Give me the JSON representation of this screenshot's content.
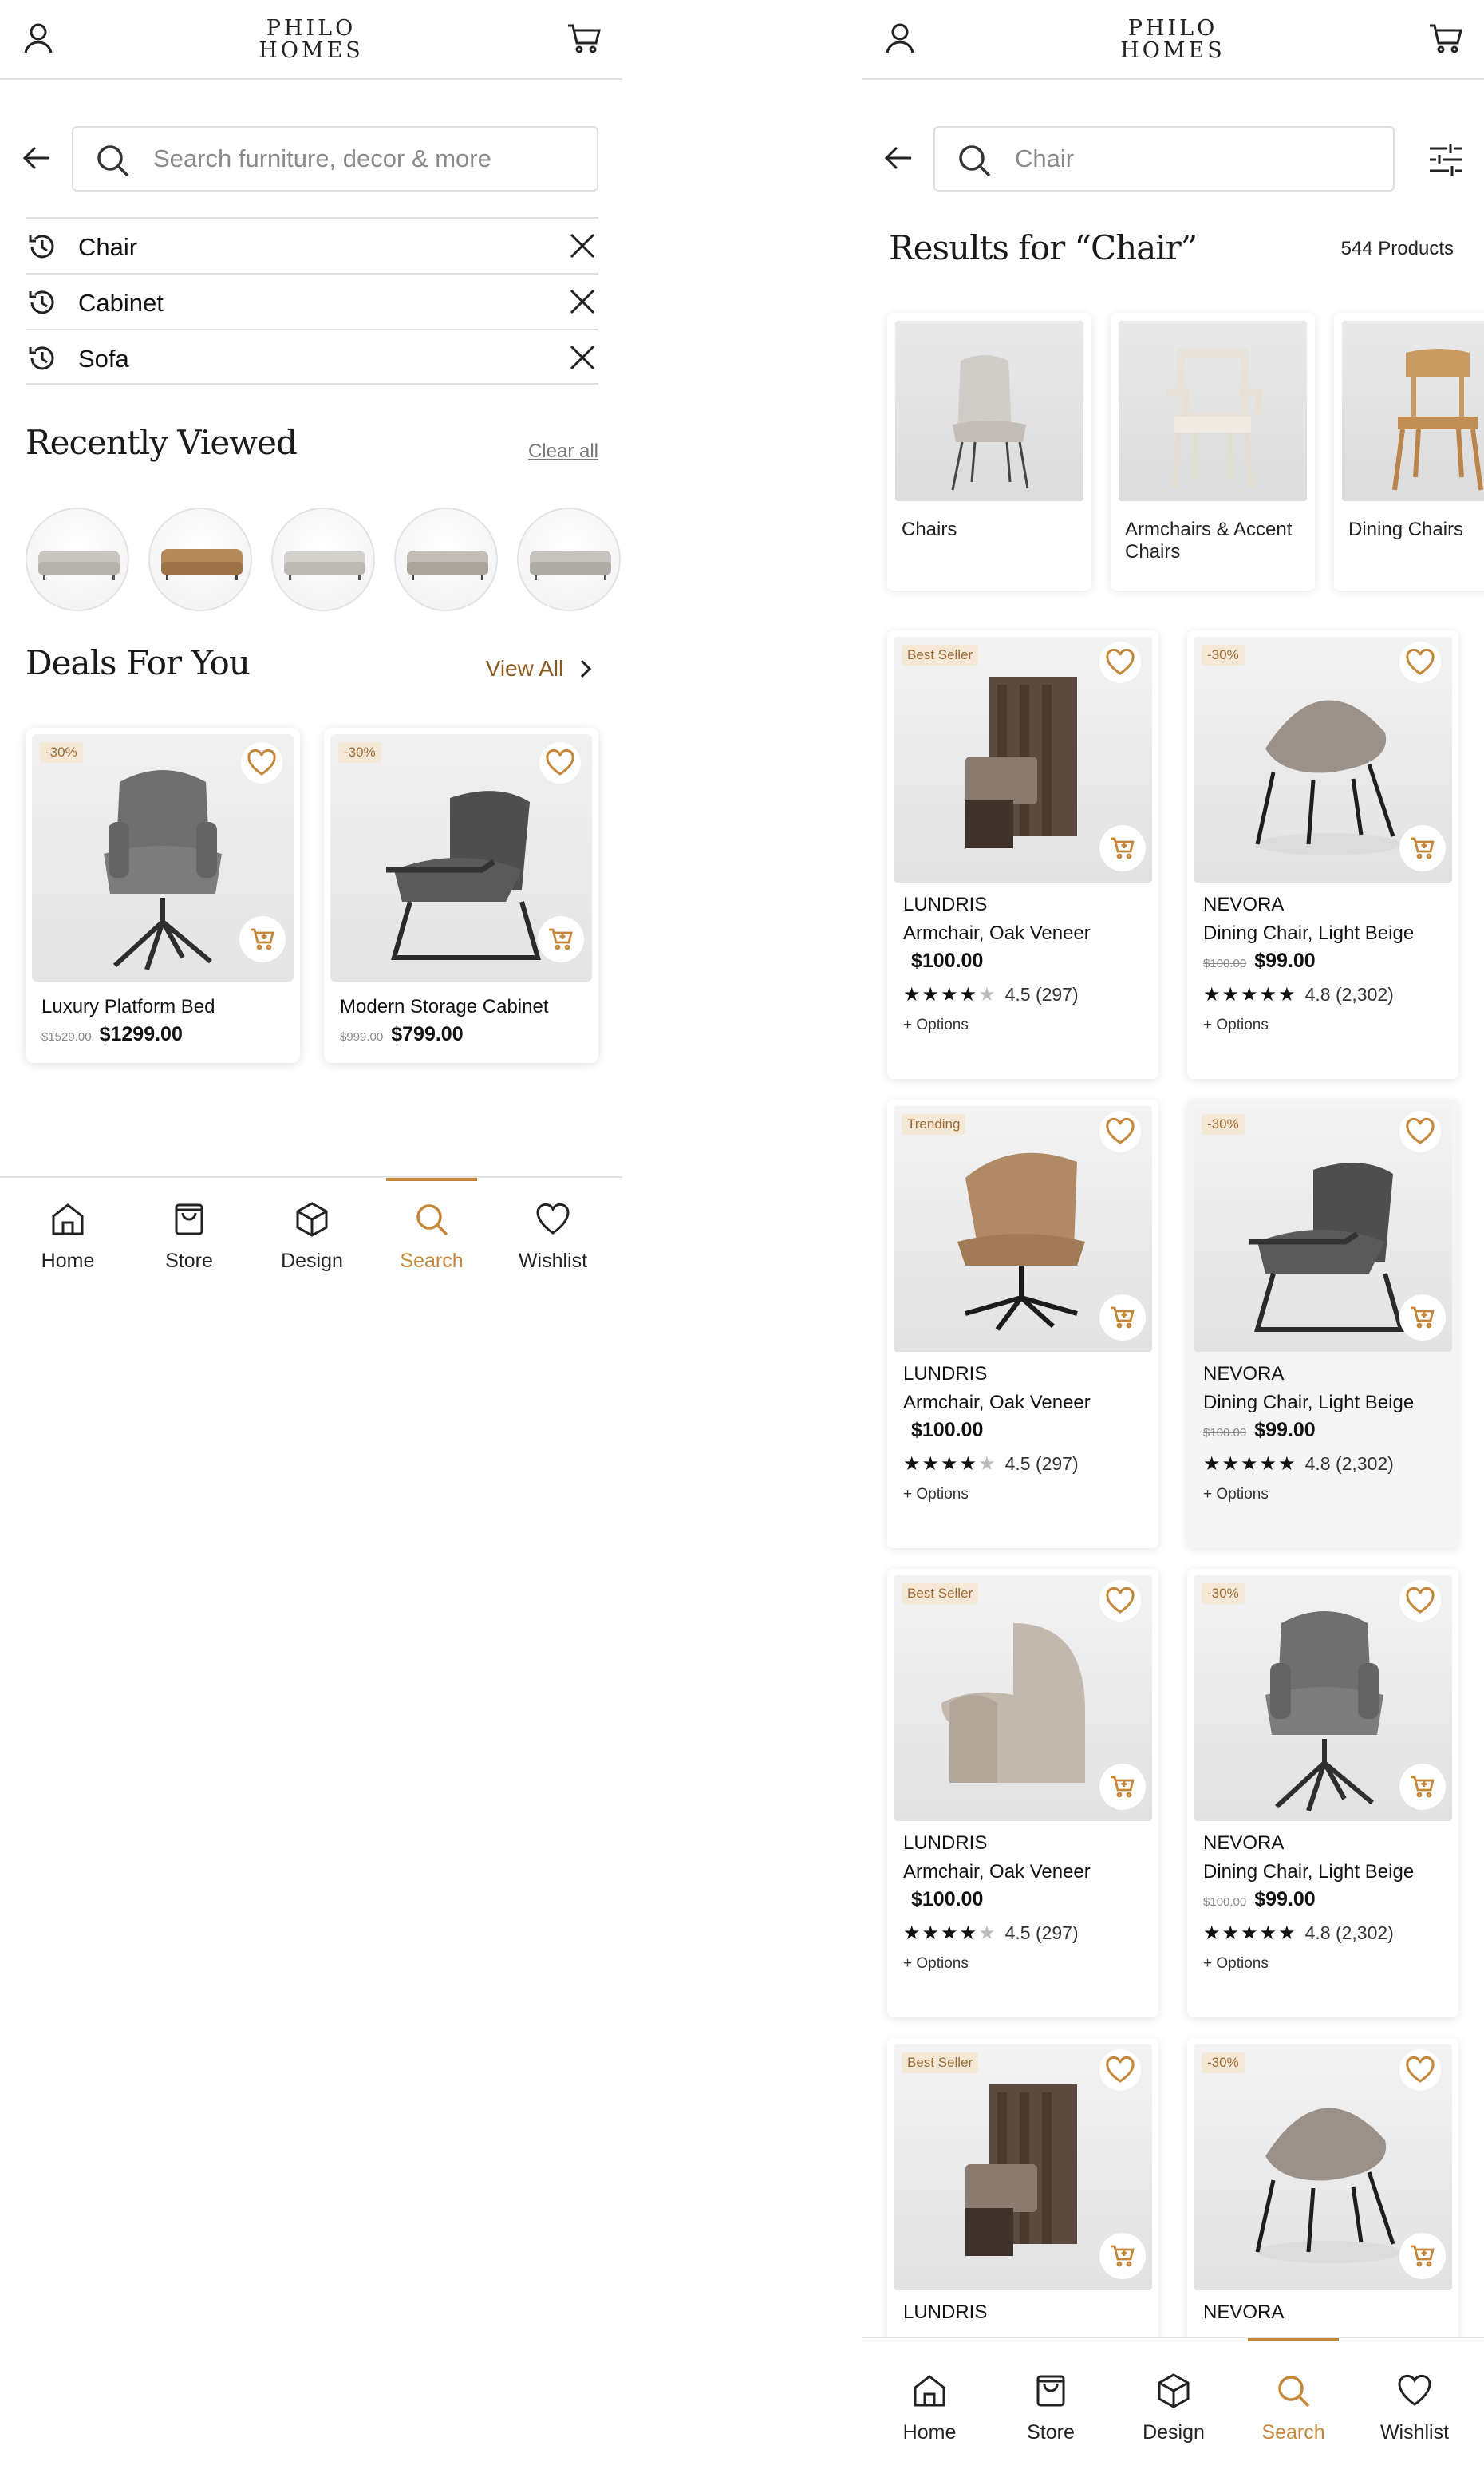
{
  "brand": {
    "line1": "PHILO",
    "line2": "HOMES"
  },
  "left": {
    "search_placeholder": "Search furniture, decor & more",
    "history": [
      "Chair",
      "Cabinet",
      "Sofa"
    ],
    "recently_viewed_title": "Recently Viewed",
    "clear_all": "Clear all",
    "deals_title": "Deals For You",
    "view_all": "View All",
    "deals": [
      {
        "badge": "-30%",
        "name": "Luxury Platform Bed",
        "old_price": "$1529.00",
        "price": "$1299.00"
      },
      {
        "badge": "-30%",
        "name": "Modern Storage Cabinet",
        "old_price": "$999.00",
        "price": "$799.00"
      }
    ]
  },
  "right": {
    "search_value": "Chair",
    "results_title": "Results for “Chair”",
    "count": "544 Products",
    "categories": [
      "Chairs",
      "Armchairs & Accent Chairs",
      "Dining Chairs"
    ],
    "products": [
      {
        "badge": "Best Seller",
        "brand": "LUNDRIS",
        "name": "Armchair, Oak Veneer",
        "old_price": "",
        "price": "$100.00",
        "rating": "4.5 (297)",
        "stars": 4,
        "options": "+ Options"
      },
      {
        "badge": "-30%",
        "brand": "NEVORA",
        "name": "Dining Chair, Light Beige",
        "old_price": "$100.00",
        "price": "$99.00",
        "rating": "4.8 (2,302)",
        "stars": 5,
        "options": "+ Options"
      },
      {
        "badge": "Trending",
        "brand": "LUNDRIS",
        "name": "Armchair, Oak Veneer",
        "old_price": "",
        "price": "$100.00",
        "rating": "4.5 (297)",
        "stars": 4,
        "options": "+ Options"
      },
      {
        "badge": "-30%",
        "brand": "NEVORA",
        "name": "Dining Chair, Light Beige",
        "old_price": "$100.00",
        "price": "$99.00",
        "rating": "4.8 (2,302)",
        "stars": 5,
        "options": "+ Options"
      },
      {
        "badge": "Best Seller",
        "brand": "LUNDRIS",
        "name": "Armchair, Oak Veneer",
        "old_price": "",
        "price": "$100.00",
        "rating": "4.5 (297)",
        "stars": 4,
        "options": "+ Options"
      },
      {
        "badge": "-30%",
        "brand": "NEVORA",
        "name": "Dining Chair, Light Beige",
        "old_price": "$100.00",
        "price": "$99.00",
        "rating": "4.8 (2,302)",
        "stars": 5,
        "options": "+ Options"
      },
      {
        "badge": "Best Seller",
        "brand": "LUNDRIS",
        "name": "",
        "old_price": "",
        "price": "",
        "rating": "",
        "stars": 0,
        "options": ""
      },
      {
        "badge": "-30%",
        "brand": "NEVORA",
        "name": "",
        "old_price": "",
        "price": "",
        "rating": "",
        "stars": 0,
        "options": ""
      }
    ]
  },
  "nav": [
    "Home",
    "Store",
    "Design",
    "Search",
    "Wishlist"
  ],
  "nav_active": "Search",
  "colors": {
    "accent": "#c4873a",
    "badge_bg": "#f6e8d6",
    "text": "#1b1b1b"
  }
}
